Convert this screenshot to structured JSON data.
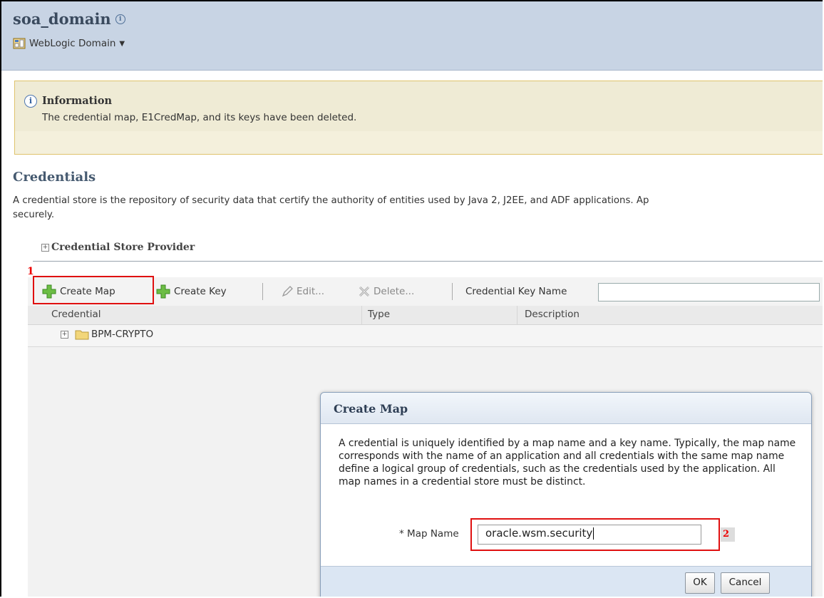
{
  "domain": {
    "title": "soa_domain",
    "menu_label": "WebLogic Domain"
  },
  "info": {
    "title": "Information",
    "message": "The credential map, E1CredMap, and its keys have been deleted."
  },
  "credentials": {
    "heading": "Credentials",
    "description": "A credential store is the repository of security data that certify the authority of entities used by Java 2, J2EE, and ADF applications. Ap",
    "description_line2": "securely.",
    "provider_section": "Credential Store Provider"
  },
  "annotations": {
    "step1": "1",
    "step2": "2"
  },
  "toolbar": {
    "create_map": "Create Map",
    "create_key": "Create Key",
    "edit": "Edit...",
    "delete": "Delete...",
    "key_name_label": "Credential Key Name",
    "key_name_value": ""
  },
  "table": {
    "columns": [
      "Credential",
      "Type",
      "Description"
    ],
    "rows": [
      {
        "credential": "BPM-CRYPTO",
        "type": "",
        "description": ""
      }
    ]
  },
  "dialog": {
    "title": "Create Map",
    "text": "A credential is uniquely identified by a map name and a key name. Typically, the map name corresponds with the name of an application and all credentials with the same map name define a logical group of credentials, such as the credentials used by the application. All map names in a credential store must be distinct.",
    "map_name_label": "Map Name",
    "map_name_required": "*",
    "map_name_value": "oracle.wsm.security",
    "ok": "OK",
    "cancel": "Cancel"
  },
  "colors": {
    "header_bg": "#c8d4e4",
    "highlight": "#e01010",
    "info_bg": "#f4f0dc",
    "dialog_footer": "#dbe6f3"
  }
}
